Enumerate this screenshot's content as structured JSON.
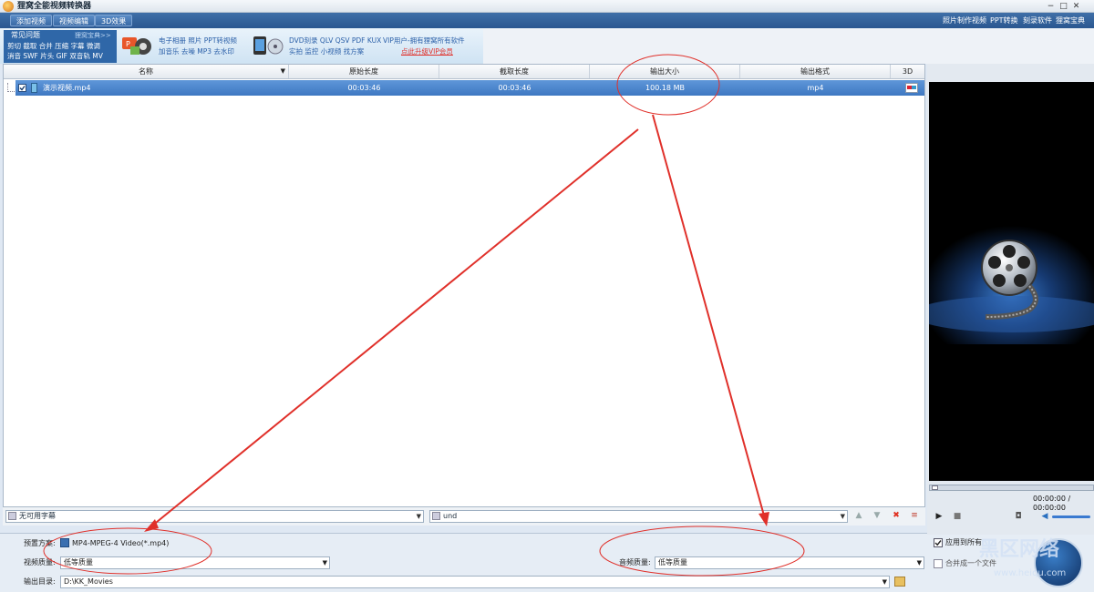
{
  "window": {
    "title": "狸窝全能视频转换器",
    "minimize_glyph": "−",
    "maximize_glyph": "□",
    "close_glyph": "✕"
  },
  "menubar": {
    "tabs": [
      "添加视频",
      "视频编辑",
      "3D效果"
    ],
    "top_links": [
      "照片制作视频",
      "PPT转换",
      "刻录软件",
      "狸窝宝典"
    ]
  },
  "banner": {
    "faq_title": "常见问题",
    "faq_more": "狸窝宝典>>",
    "faq_lines": [
      "剪切 截取 合并 压缩 字幕 微调",
      "消音 SWF 片头 GIF 双音轨 MV"
    ],
    "promo1_lines": [
      "电子相册 照片 PPT转视频",
      "加音乐 去噪 MP3 去水印"
    ],
    "promo2_lines": [
      "DVD刻录 QLV QSV PDF KUX",
      "实拍 监控 小视频 找方案"
    ],
    "vip_text": "VIP用户-拥有狸窝所有软件",
    "vip_link": "点此升级VIP会员"
  },
  "table": {
    "headers": [
      "名称",
      "原始长度",
      "截取长度",
      "输出大小",
      "输出格式",
      "3D"
    ],
    "rows": [
      {
        "name": "演示视频.mp4",
        "original_length": "00:03:46",
        "cut_length": "00:03:46",
        "output_size": "100.18 MB",
        "output_format": "mp4"
      }
    ]
  },
  "bottombar": {
    "subtitle": "无可用字幕",
    "audio_track": "und"
  },
  "settings": {
    "preset_label": "预置方案:",
    "preset_value": "MP4-MPEG-4 Video(*.mp4)",
    "video_quality_label": "视频质量:",
    "video_quality_value": "低等质量",
    "audio_quality_label": "音频质量:",
    "audio_quality_value": "低等质量",
    "output_dir_label": "输出目录:",
    "output_dir_value": "D:\\KK_Movies",
    "apply_all_label": "应用到所有",
    "merge_label": "合并成一个文件"
  },
  "preview": {
    "time": "00:00:00 / 00:00:00"
  },
  "watermark": {
    "brand": "黑区网络",
    "url": "www.heiqu.com"
  },
  "colors": {
    "accent": "#2f67a8",
    "selected_row": "#4a84cc",
    "annotation": "#e0302a"
  }
}
